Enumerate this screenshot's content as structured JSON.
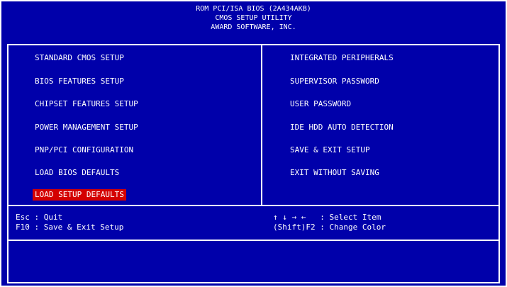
{
  "header": {
    "line1": "ROM PCI/ISA BIOS (2A434AKB)",
    "line2": "CMOS SETUP UTILITY",
    "line3": "AWARD SOFTWARE, INC."
  },
  "menu": {
    "left": [
      "STANDARD CMOS SETUP",
      "BIOS FEATURES SETUP",
      "CHIPSET FEATURES SETUP",
      "POWER MANAGEMENT SETUP",
      "PNP/PCI CONFIGURATION",
      "LOAD BIOS DEFAULTS",
      "LOAD SETUP DEFAULTS"
    ],
    "right": [
      "INTEGRATED PERIPHERALS",
      "SUPERVISOR PASSWORD",
      "USER PASSWORD",
      "IDE HDD AUTO DETECTION",
      "SAVE & EXIT SETUP",
      "EXIT WITHOUT SAVING"
    ],
    "selected_color": "#d40000"
  },
  "help": {
    "esc": "Esc : Quit",
    "f10": "F10 : Save & Exit Setup",
    "select": "↑ ↓ → ←   : Select Item",
    "color": "(Shift)F2 : Change Color"
  },
  "colors": {
    "background": "#0000aa",
    "text": "#ffffff"
  }
}
